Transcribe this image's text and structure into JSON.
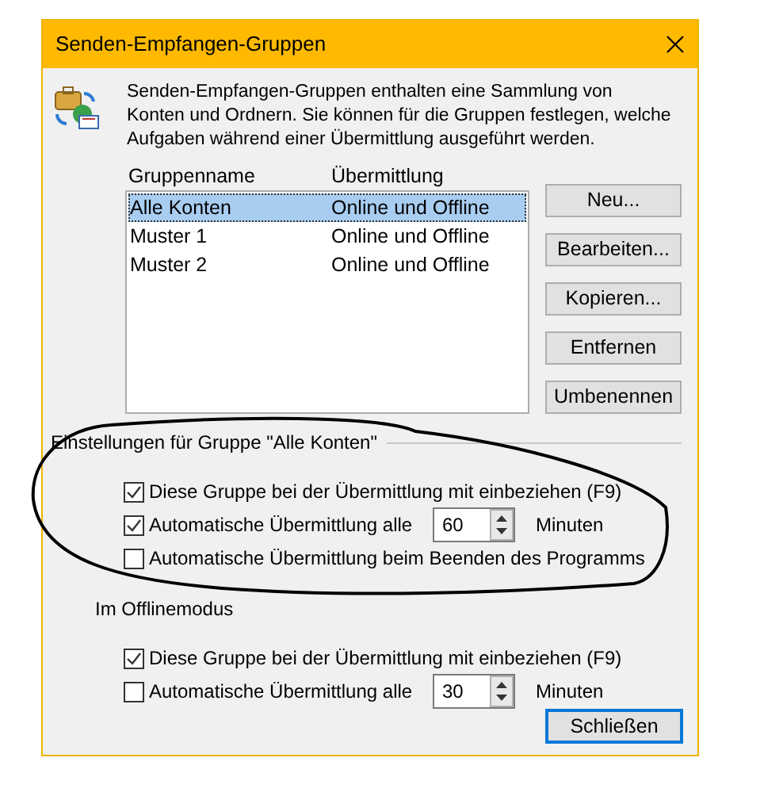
{
  "window": {
    "title": "Senden-Empfangen-Gruppen"
  },
  "description": "Senden-Empfangen-Gruppen enthalten eine Sammlung von Konten und Ordnern. Sie können für die Gruppen festlegen, welche Aufgaben während einer Übermittlung ausgeführt werden.",
  "table": {
    "columns": [
      "Gruppenname",
      "Übermittlung"
    ],
    "rows": [
      {
        "cells": [
          "Alle Konten",
          "Online und Offline"
        ],
        "selected": true
      },
      {
        "cells": [
          "Muster 1",
          "Online und Offline"
        ],
        "selected": false
      },
      {
        "cells": [
          "Muster 2",
          "Online und Offline"
        ],
        "selected": false
      }
    ]
  },
  "buttons": [
    "Neu...",
    "Bearbeiten...",
    "Kopieren...",
    "Entfernen",
    "Umbenennen"
  ],
  "groups": [
    {
      "title": "Einstellungen für Gruppe \"Alle Konten\"",
      "kind": "separator",
      "options": [
        {
          "kind": "checkbox",
          "label": "Diese Gruppe bei der Übermittlung mit einbeziehen (F9)",
          "checked": true
        },
        {
          "kind": "interval",
          "label": "Automatische Übermittlung alle",
          "checked": true,
          "value": "60",
          "unit": "Minuten"
        },
        {
          "kind": "checkbox",
          "label": "Automatische Übermittlung beim Beenden des Programms",
          "checked": false
        }
      ]
    },
    {
      "title": "Im Offlinemodus",
      "kind": "plain",
      "options": [
        {
          "kind": "checkbox",
          "label": "Diese Gruppe bei der Übermittlung mit einbeziehen (F9)",
          "checked": true
        },
        {
          "kind": "interval",
          "label": "Automatische Übermittlung alle",
          "checked": false,
          "value": "30",
          "unit": "Minuten"
        }
      ]
    }
  ],
  "close_button": "Schließen"
}
